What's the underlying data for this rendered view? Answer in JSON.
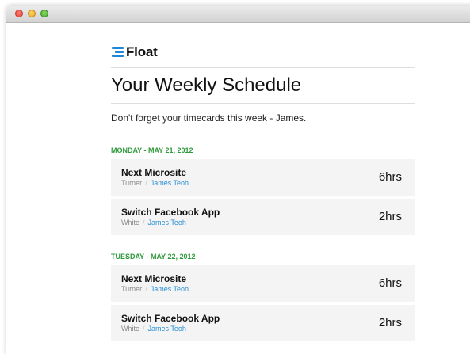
{
  "window": {
    "buttons": [
      "close",
      "minimize",
      "zoom"
    ],
    "colors": {
      "close": "#e0443a",
      "minimize": "#e6a526",
      "zoom": "#4aa92c"
    }
  },
  "brand": {
    "name": "Float",
    "icon": "float-logo-icon",
    "accent": "#1e88d6"
  },
  "header": {
    "title": "Your Weekly Schedule",
    "message": "Don't forget your timecards this week - James."
  },
  "colors": {
    "day_heading": "#2f9a3b",
    "person_link": "#2a8fd6",
    "card_background": "#f4f4f4"
  },
  "days": [
    {
      "label": "MONDAY - MAY 21, 2012",
      "tasks": [
        {
          "project": "Next Microsite",
          "client": "Turner",
          "person": "James Teoh",
          "hours": "6hrs"
        },
        {
          "project": "Switch Facebook App",
          "client": "White",
          "person": "James Teoh",
          "hours": "2hrs"
        }
      ]
    },
    {
      "label": "TUESDAY - MAY 22, 2012",
      "tasks": [
        {
          "project": "Next Microsite",
          "client": "Turner",
          "person": "James Teoh",
          "hours": "6hrs"
        },
        {
          "project": "Switch Facebook App",
          "client": "White",
          "person": "James Teoh",
          "hours": "2hrs"
        }
      ]
    }
  ]
}
